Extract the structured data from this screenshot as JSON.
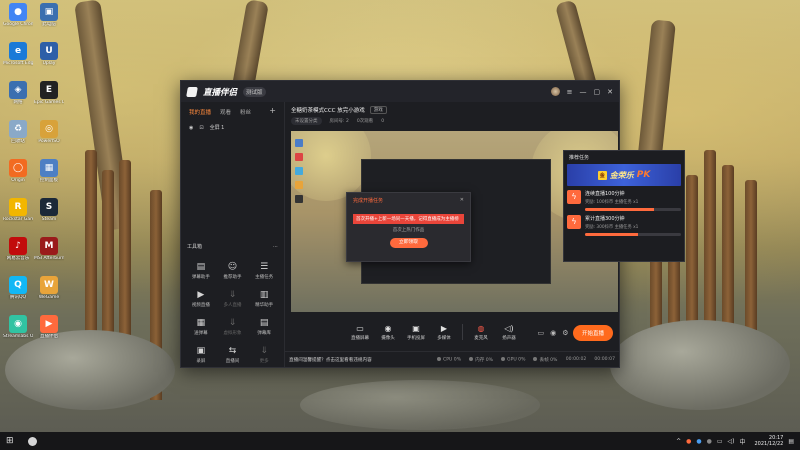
{
  "desktop_icons": [
    {
      "label": "Google Chrome",
      "color": "#4285f4",
      "glyph": "●"
    },
    {
      "label": "此电脑",
      "color": "#3b6fb0",
      "glyph": "▣"
    },
    {
      "label": "Microsoft Edge",
      "color": "#1a7ad8",
      "glyph": "e"
    },
    {
      "label": "Uplay",
      "color": "#2d5fa8",
      "glyph": "U"
    },
    {
      "label": "网络",
      "color": "#3b6fb0",
      "glyph": "◈"
    },
    {
      "label": "Epic Games Launcher",
      "color": "#222222",
      "glyph": "E"
    },
    {
      "label": "回收站",
      "color": "#8aa9c8",
      "glyph": "♻"
    },
    {
      "label": "PowerISO",
      "color": "#d8a23a",
      "glyph": "◎"
    },
    {
      "label": "Origin",
      "color": "#f26b21",
      "glyph": "◯"
    },
    {
      "label": "控制面板",
      "color": "#4d7fc4",
      "glyph": "▦"
    },
    {
      "label": "Rockstar Games",
      "color": "#f2b600",
      "glyph": "R"
    },
    {
      "label": "Steam",
      "color": "#1b2838",
      "glyph": "S"
    },
    {
      "label": "网易云音乐",
      "color": "#c20c0c",
      "glyph": "♪"
    },
    {
      "label": "MSI Afterburner",
      "color": "#9a1b1b",
      "glyph": "M"
    },
    {
      "label": "腾讯QQ",
      "color": "#12b7f5",
      "glyph": "Q"
    },
    {
      "label": "WeGame",
      "color": "#e8a43a",
      "glyph": "W"
    },
    {
      "label": "Streamlabs OBS",
      "color": "#31c3a2",
      "glyph": "◉"
    },
    {
      "label": "直播伴侣",
      "color": "#ff6a3d",
      "glyph": "▶"
    }
  ],
  "window": {
    "app_name": "直播伴侣",
    "version": "测试版",
    "sidebar": {
      "tabs": [
        "我的直播",
        "观看",
        "粉丝"
      ],
      "active_tab": 0,
      "scene": "全屏 1",
      "tools_title": "工具箱",
      "tools": [
        {
          "label": "弹幕助手",
          "glyph": "▤",
          "disabled": false
        },
        {
          "label": "推荐助手",
          "glyph": "☺",
          "disabled": false
        },
        {
          "label": "主播任务",
          "glyph": "☰",
          "disabled": false
        },
        {
          "label": "视频直播",
          "glyph": "▶",
          "disabled": false
        },
        {
          "label": "多人直播",
          "glyph": "⇓",
          "disabled": true
        },
        {
          "label": "精华助手",
          "glyph": "▥",
          "disabled": false
        },
        {
          "label": "送弹幕",
          "glyph": "▦",
          "disabled": false
        },
        {
          "label": "虚拟形象",
          "glyph": "⇓",
          "disabled": true
        },
        {
          "label": "弹幕库",
          "glyph": "▤",
          "disabled": false
        },
        {
          "label": "录屏",
          "glyph": "▣",
          "disabled": false
        },
        {
          "label": "直播间",
          "glyph": "⇆",
          "disabled": false
        },
        {
          "label": "更多",
          "glyph": "⇓",
          "disabled": true
        }
      ]
    },
    "room": {
      "title": "全糖奶茶模式CCC 放完小游戏",
      "tag": "游戏",
      "meta": [
        "未设置分类",
        "房间号: 2",
        "0次观看",
        "0"
      ]
    },
    "popup": {
      "title": "完成开播任务",
      "banner": "首次开播+上新一场同一天播，记得直播成为主播榜",
      "sub": "首次上热门作品",
      "button": "立即领取"
    },
    "tasks": {
      "title": "推荐任务",
      "pk_badge": "金",
      "pk_text": "金荣乐",
      "pk_pk": "PK",
      "items": [
        {
          "name": "连续直播100分钟",
          "reward": "奖励: 100抖币 主播任务 x1",
          "progress": 0.72
        },
        {
          "name": "累计直播300分钟",
          "reward": "奖励: 300抖币 主播任务 x1",
          "progress": 0.55
        }
      ]
    },
    "toolbar": [
      {
        "label": "直播屏幕",
        "glyph": "▭"
      },
      {
        "label": "摄像头",
        "glyph": "◉"
      },
      {
        "label": "手机投屏",
        "glyph": "▣"
      },
      {
        "label": "多媒体",
        "glyph": "▶"
      },
      {
        "label": "麦克风",
        "glyph": "◍",
        "red": true
      },
      {
        "label": "扬声器",
        "glyph": "◁)"
      }
    ],
    "live_button": "开始直播",
    "status": {
      "notice": "直播间温馨提醒？点击这里看看违规内容",
      "stats": [
        "CPU 0%",
        "内存 0%",
        "GPU 0%",
        "丢帧 0%"
      ],
      "time_left": "00:00:02",
      "time_right": "00:00:07"
    }
  },
  "taskbar": {
    "time": "20:17",
    "date": "2021/12/22"
  }
}
